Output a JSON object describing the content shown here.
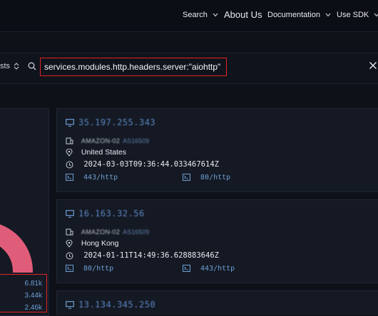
{
  "nav": {
    "search": "Search",
    "about": "About Us",
    "documentation": "Documentation",
    "sdk": "Use SDK"
  },
  "search": {
    "scope_label": "sts",
    "query": "services.modules.http.headers.server:\"aiohttp\""
  },
  "stats": {
    "values": [
      "6.81k",
      "3.44k",
      "2.46k"
    ]
  },
  "results": [
    {
      "ip": "35.197.255.343",
      "org": "AMAZON-02",
      "org_extra": "AS16509",
      "location": "United States",
      "timestamp": "2024-03-03T09:36:44.033467614Z",
      "ports": [
        "443/http",
        "80/http"
      ]
    },
    {
      "ip": "16.163.32.56",
      "org": "AMAZON-02",
      "org_extra": "AS16509",
      "location": "Hong Kong",
      "timestamp": "2024-01-11T14:49:36.628883646Z",
      "ports": [
        "80/http",
        "443/http"
      ]
    },
    {
      "ip": "13.134.345.250"
    }
  ],
  "colors": {
    "highlight_border": "#e02424",
    "link": "#6e9fd6",
    "donut_primary": "#e05d7a",
    "donut_secondary": "#3d8fd6"
  }
}
